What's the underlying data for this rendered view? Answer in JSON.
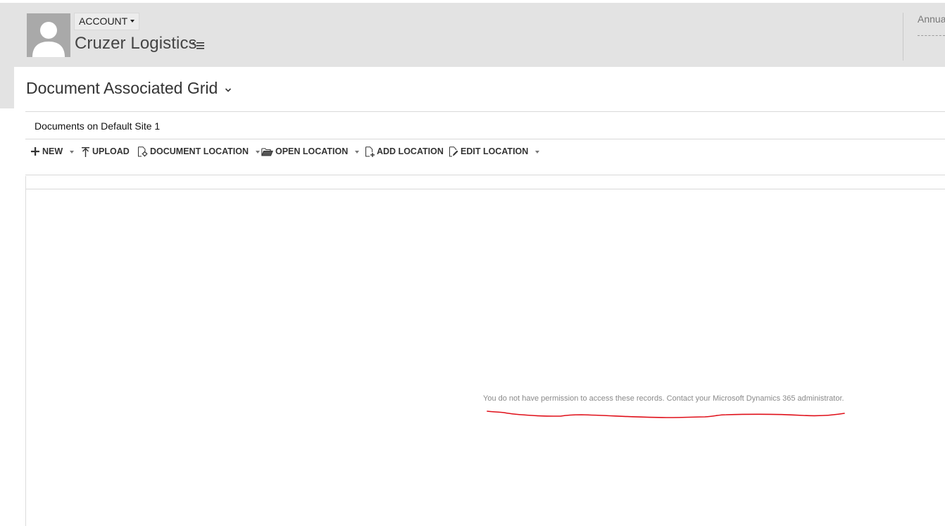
{
  "header": {
    "entity_label": "ACCOUNT",
    "record_title": "Cruzer Logistics",
    "side_field_label": "Annua"
  },
  "grid": {
    "title": "Document Associated Grid",
    "location": "Documents on Default Site 1"
  },
  "toolbar": {
    "new_label": "NEW",
    "upload_label": "UPLOAD",
    "document_location_label": "DOCUMENT LOCATION",
    "open_location_label": "OPEN LOCATION",
    "add_location_label": "ADD LOCATION",
    "edit_location_label": "EDIT LOCATION"
  },
  "message": {
    "permission": "You do not have permission to access these records. Contact your Microsoft Dynamics 365 administrator."
  },
  "colors": {
    "header_bg": "#e3e3e3",
    "annotation": "#e0101a",
    "message_text": "#8a8a8a"
  },
  "icons": {
    "avatar": "person-silhouette-icon",
    "new": "plus-icon",
    "upload": "upload-arrow-icon",
    "document_location": "document-gear-icon",
    "open_location": "folder-open-icon",
    "add_location": "document-add-icon",
    "edit_location": "document-edit-icon"
  }
}
